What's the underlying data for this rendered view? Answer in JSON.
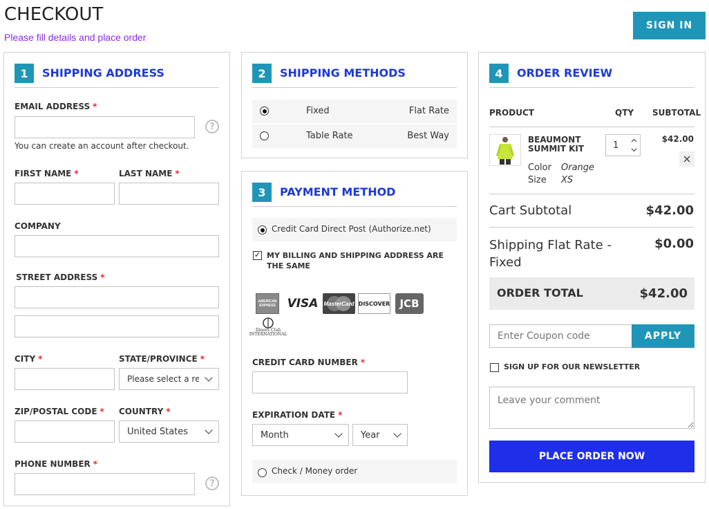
{
  "header": {
    "title": "CHECKOUT",
    "subtitle": "Please fill details and place order",
    "signin_label": "SIGN IN"
  },
  "shipping_address": {
    "num": "1",
    "title": "SHIPPING ADDRESS",
    "email_label": "EMAIL ADDRESS",
    "email_note": "You can create an account after checkout.",
    "first_name_label": "FIRST NAME",
    "last_name_label": "LAST NAME",
    "company_label": "COMPANY",
    "street_label": "STREET ADDRESS",
    "city_label": "CITY",
    "state_label": "STATE/PROVINCE",
    "state_value": "Please select a region",
    "zip_label": "ZIP/POSTAL CODE",
    "country_label": "COUNTRY",
    "country_value": "United States",
    "phone_label": "PHONE NUMBER",
    "required_mark": "*",
    "help_glyph": "?"
  },
  "shipping_methods": {
    "num": "2",
    "title": "SHIPPING METHODS",
    "options": [
      {
        "name": "Fixed",
        "carrier": "Flat Rate",
        "selected": true
      },
      {
        "name": "Table Rate",
        "carrier": "Best Way",
        "selected": false
      }
    ]
  },
  "payment": {
    "num": "3",
    "title": "PAYMENT METHOD",
    "option_cc": "Credit Card Direct Post (Authorize.net)",
    "billing_same": "MY BILLING AND SHIPPING ADDRESS ARE THE SAME",
    "cards": [
      "AMERICAN EXPRESS",
      "VISA",
      "MasterCard",
      "DISCOVER",
      "JCB",
      "Diners Club INTERNATIONAL"
    ],
    "cc_number_label": "CREDIT CARD NUMBER",
    "expiration_label": "EXPIRATION DATE",
    "month_value": "Month",
    "year_value": "Year",
    "option_check": "Check / Money order"
  },
  "review": {
    "num": "4",
    "title": "ORDER REVIEW",
    "col_product": "PRODUCT",
    "col_qty": "QTY",
    "col_subtotal": "SUBTOTAL",
    "item": {
      "name": "BEAUMONT SUMMIT KIT",
      "qty": "1",
      "price": "$42.00",
      "color_label": "Color",
      "color_value": "Orange",
      "size_label": "Size",
      "size_value": "XS"
    },
    "cart_subtotal_label": "Cart Subtotal",
    "cart_subtotal_value": "$42.00",
    "shipping_label": "Shipping Flat Rate - Fixed",
    "shipping_value": "$0.00",
    "order_total_label": "ORDER TOTAL",
    "order_total_value": "$42.00",
    "coupon_placeholder": "Enter Coupon code",
    "apply_label": "APPLY",
    "newsletter_label": "SIGN UP FOR OUR NEWSLETTER",
    "comment_placeholder": "Leave your comment",
    "place_order_label": "PLACE ORDER NOW"
  },
  "colors": {
    "accent": "#1f96b8",
    "section_title": "#1d39d6",
    "place_order": "#1f2ee8",
    "required": "#e02b27",
    "subtitle": "#8a2be2"
  }
}
